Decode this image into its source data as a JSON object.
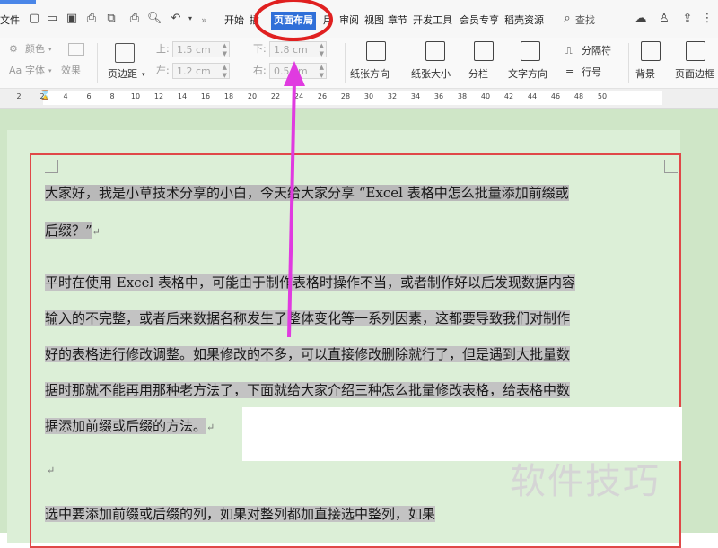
{
  "tabs": {
    "file": "文件",
    "start": "开始",
    "insert": "插",
    "page_layout": "页面布局",
    "reference": "用",
    "review": "审阅",
    "view": "视图",
    "chapter": "章节",
    "dev_tools": "开发工具",
    "member": "会员专享",
    "resources": "稻壳资源",
    "search": "查找",
    "more": "»"
  },
  "ribbon": {
    "color": "颜色",
    "font": "字体",
    "effect": "效果",
    "margin": "页边距",
    "top_label": "上:",
    "top_value": "1.5 cm",
    "bottom_label": "下:",
    "bottom_value": "1.8 cm",
    "left_label": "左:",
    "left_value": "1.2 cm",
    "right_label": "右:",
    "right_value": "0.5 cm",
    "orientation": "纸张方向",
    "paper_size": "纸张大小",
    "columns": "分栏",
    "text_direction": "文字方向",
    "separator": "分隔符",
    "line_number": "行号",
    "background": "背景",
    "page_border": "页面边框"
  },
  "ruler": [
    "2",
    "2",
    "4",
    "6",
    "8",
    "10",
    "12",
    "14",
    "16",
    "18",
    "20",
    "22",
    "24",
    "26",
    "28",
    "30",
    "32",
    "34",
    "36",
    "38",
    "40",
    "42",
    "44",
    "46",
    "48",
    "50"
  ],
  "doc": {
    "line1": "大家好，我是小草技术分享的小白，今天给大家分享 “Excel 表格中怎么批量添加前缀或",
    "line2": "后缀？”",
    "line3": "平时在使用 Excel 表格中，可能由于制作表格时操作不当，或者制作好以后发现数据内容",
    "line4": "输入的不完整，或者后来数据名称发生了整体变化等一系列因素，这都要导致我们对制作",
    "line5": "好的表格进行修改调整。如果修改的不多，可以直接修改删除就行了，但是遇到大批量数",
    "line6": "据时那就不能再用那种老方法了，下面就给大家介绍三种怎么批量修改表格，给表格中数",
    "line7": "据添加前缀或后缀的方法。",
    "line8": "选中要添加前缀或后缀的列，如果对整列都加直接选中整列，如果",
    "paragraph_mark": "↵"
  },
  "watermark": "软件技巧",
  "colors": {
    "active_tab": "#2f6fd8",
    "annotation": "#e03be0",
    "highlight_circle": "#e02020",
    "page_bg": "#cfe6c7"
  }
}
